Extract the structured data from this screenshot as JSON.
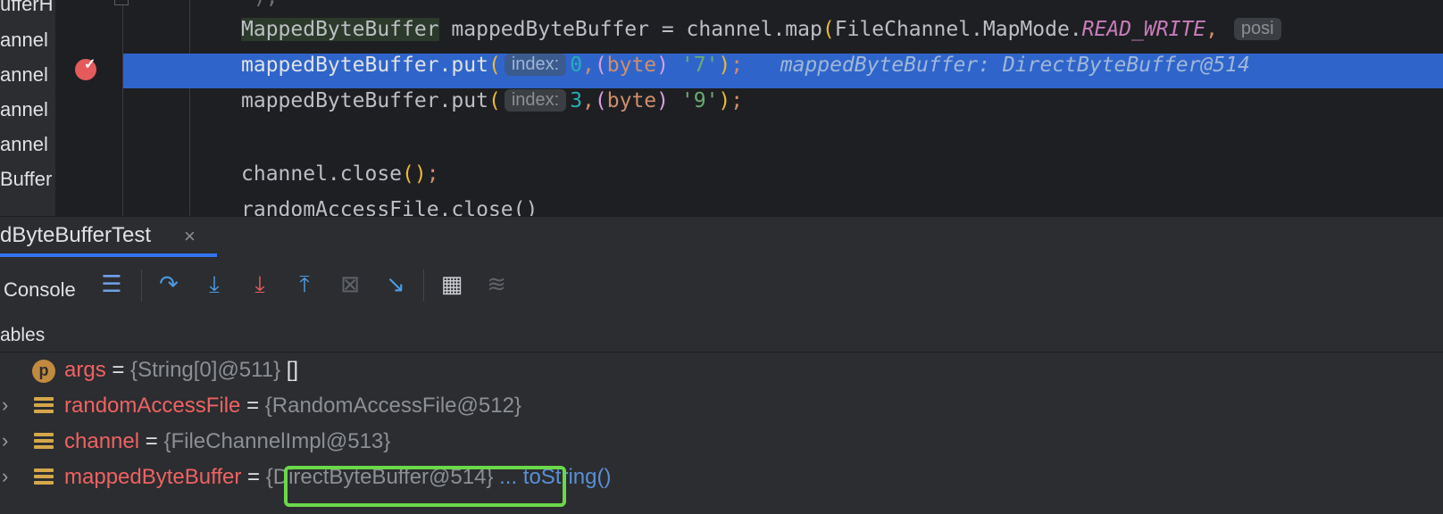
{
  "project_tree": {
    "items": [
      "ufferH",
      "annel",
      "annel",
      "annel",
      "annel",
      "Buffer"
    ]
  },
  "editor": {
    "line_above": "\");",
    "line1": {
      "class_name": "MappedByteBuffer",
      "var_name": "mappedByteBuffer",
      "eq": " = ",
      "call": "channel.map",
      "open": "(",
      "arg_class": "FileChannel.MapMode.",
      "arg_field": "READ_WRITE",
      "comma": ",",
      "hint": "posi"
    },
    "line2": {
      "call": "mappedByteBuffer.put",
      "open": "(",
      "hint": "index:",
      "num": "0",
      "comma": ",",
      "cast_open": "(",
      "cast_kw": "byte",
      "cast_close": ")",
      "str": "'7'",
      "close": ")",
      "semi": ";",
      "inline_value": "mappedByteBuffer: DirectByteBuffer@514"
    },
    "line3": {
      "call": "mappedByteBuffer.put",
      "open": "(",
      "hint": "index:",
      "num": "3",
      "comma": ",",
      "cast_open": "(",
      "cast_kw": "byte",
      "cast_close": ")",
      "str": "'9'",
      "close": ")",
      "semi": ";"
    },
    "line5": {
      "call": "channel.close",
      "parens": "()",
      "semi": ";"
    },
    "line6_partial": "randomAccessFile.close()"
  },
  "debug_tab": {
    "title": "dByteBufferTest",
    "close": "×"
  },
  "toolbar": {
    "console_label": "Console",
    "icons": [
      "list-icon",
      "step-over-icon",
      "step-into-icon",
      "force-step-into-icon",
      "step-out-icon",
      "drop-frame-icon",
      "run-to-cursor-icon",
      "evaluate-icon",
      "trace-icon"
    ]
  },
  "variables": {
    "header": "ables",
    "rows": [
      {
        "icon": "p",
        "name": "args",
        "eq": " = ",
        "value": "{String[0]@511}",
        "extra": " []"
      },
      {
        "icon": "field",
        "name": "randomAccessFile",
        "eq": " = ",
        "value": "{RandomAccessFile@512}",
        "extra": ""
      },
      {
        "icon": "field",
        "name": "channel",
        "eq": " = ",
        "value": "{FileChannelImpl@513}",
        "extra": ""
      },
      {
        "icon": "field",
        "name": "mappedByteBuffer",
        "eq": " = ",
        "value": "{DirectByteBuffer@514}",
        "dots": " ...",
        "link": " toString()"
      }
    ]
  },
  "colors": {
    "highlight_box": "#6bd84a",
    "selected_line": "#2f65ca",
    "breakpoint": "#e55b5b"
  }
}
